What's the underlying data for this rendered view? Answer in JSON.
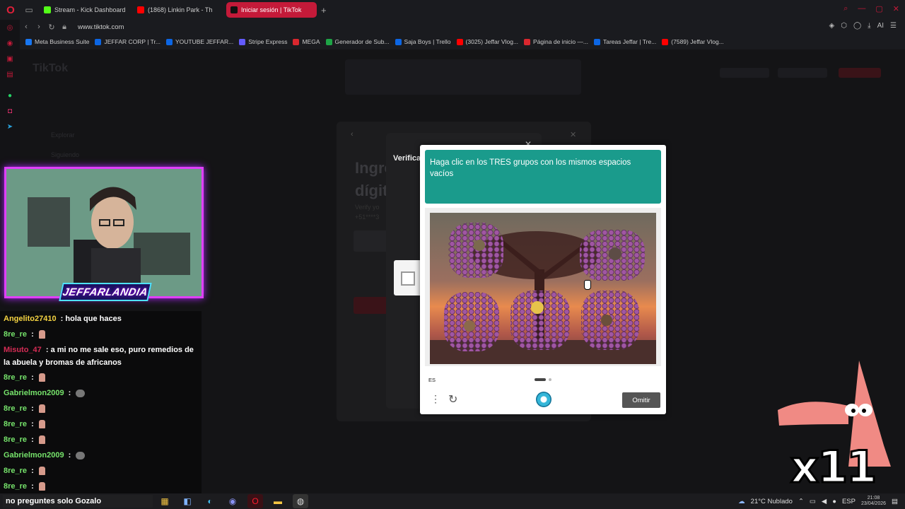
{
  "browser": {
    "tabs": [
      {
        "label": "Stream - Kick Dashboard",
        "color": "#53fc18",
        "active": false
      },
      {
        "label": "(1868) Linkin Park - Th",
        "color": "#ff0000",
        "active": false
      },
      {
        "label": "Iniciar sesión | TikTok",
        "color": "#111111",
        "active": true
      }
    ],
    "url": "www.tiktok.com",
    "ai_label": "AI",
    "bookmarks": [
      {
        "label": "Meta Business Suite",
        "color": "#1877f2"
      },
      {
        "label": "JEFFAR CORP | Tr...",
        "color": "#0c66e4"
      },
      {
        "label": "YOUTUBE JEFFAR...",
        "color": "#0c66e4"
      },
      {
        "label": "Stripe Express",
        "color": "#635bff"
      },
      {
        "label": "MEGA",
        "color": "#d9272e"
      },
      {
        "label": "Generador de Sub...",
        "color": "#1ea446"
      },
      {
        "label": "Saja Boys | Trello",
        "color": "#0c66e4"
      },
      {
        "label": "(3025) Jeffar Vlog...",
        "color": "#ff0000"
      },
      {
        "label": "Página de inicio —...",
        "color": "#d9272e"
      },
      {
        "label": "Tareas Jeffar | Tre...",
        "color": "#0c66e4"
      },
      {
        "label": "(7589) Jeffar Vlog...",
        "color": "#ff0000"
      }
    ]
  },
  "tiktok": {
    "logo": "TikTok",
    "login_title_1": "Ingre",
    "login_title_2": "dígit",
    "login_sub_1": "Verify yo",
    "login_sub_2": "+51****3",
    "field_placeholder": "Ingresa",
    "verify_label": "Verifica",
    "side_items": [
      "Explorar",
      "Siguiendo"
    ]
  },
  "captcha": {
    "instruction": "Haga clic en los TRES grupos con los mismos espacios vacíos",
    "language": "ES",
    "skip_label": "Omitir",
    "header_color": "#1a9b8c"
  },
  "stream": {
    "brand": "JEFFARLANDIA",
    "multiplier": "x11",
    "ticker": "no preguntes solo Gozalo",
    "chat": [
      {
        "user": "Angelito27410",
        "text": "hola que haces",
        "color": "#f5d442",
        "emote": ""
      },
      {
        "user": "8re_re",
        "text": "",
        "color": "#76e36b",
        "emote": "hand"
      },
      {
        "user": "Misuto_47",
        "text": "a mi no me sale eso, puro remedios de la abuela y bromas de africanos",
        "color": "#d62c55",
        "emote": ""
      },
      {
        "user": "8re_re",
        "text": "",
        "color": "#76e36b",
        "emote": "hand"
      },
      {
        "user": "Gabrielmon2009",
        "text": "",
        "color": "#76e36b",
        "emote": "face"
      },
      {
        "user": "8re_re",
        "text": "",
        "color": "#76e36b",
        "emote": "hand"
      },
      {
        "user": "8re_re",
        "text": "",
        "color": "#76e36b",
        "emote": "hand"
      },
      {
        "user": "8re_re",
        "text": "",
        "color": "#76e36b",
        "emote": "hand"
      },
      {
        "user": "Gabrielmon2009",
        "text": "",
        "color": "#76e36b",
        "emote": "face"
      },
      {
        "user": "8re_re",
        "text": "",
        "color": "#76e36b",
        "emote": "hand"
      },
      {
        "user": "8re_re",
        "text": "",
        "color": "#76e36b",
        "emote": "hand"
      }
    ]
  },
  "taskbar": {
    "weather": "21°C  Nublado",
    "lang": "ESP",
    "time": "21:08",
    "date": "23/04/2026"
  }
}
